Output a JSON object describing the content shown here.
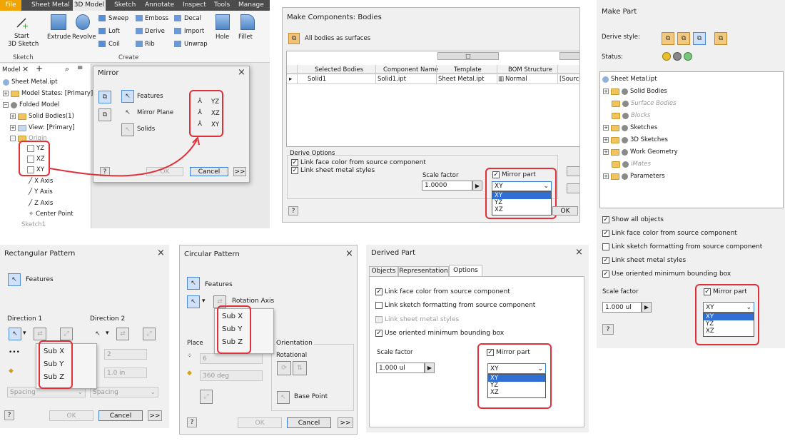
{
  "colors": {
    "highlight": "#e0313a",
    "selection": "#2f6fd6",
    "ribbon_tab_active": "#f0a500"
  },
  "ribbon": {
    "tabs": [
      "File",
      "Sheet Metal",
      "3D Model",
      "Sketch",
      "Annotate",
      "Inspect",
      "Tools",
      "Manage"
    ],
    "active_tab": "3D Model",
    "start_sketch": "Start\n3D Sketch",
    "start_sketch_l1": "Start",
    "start_sketch_l2": "3D Sketch",
    "extrude": "Extrude",
    "revolve": "Revolve",
    "sweep": "Sweep",
    "loft": "Loft",
    "coil": "Coil",
    "emboss": "Emboss",
    "derive": "Derive",
    "rib": "Rib",
    "decal": "Decal",
    "import": "Import",
    "unwrap": "Unwrap",
    "hole": "Hole",
    "fillet": "Fillet",
    "group_sketch": "Sketch",
    "group_create": "Create"
  },
  "browser": {
    "tab": "Model",
    "items": [
      "Sheet Metal.ipt",
      "Model States: [Primary]",
      "Folded Model",
      "Solid Bodies(1)",
      "View: [Primary]",
      "Origin",
      "YZ",
      "XZ",
      "XY",
      "X Axis",
      "Y Axis",
      "Z Axis",
      "Center Point",
      "Sketch1"
    ]
  },
  "mirror": {
    "title": "Mirror",
    "features": "Features",
    "mirror_plane": "Mirror Plane",
    "solids": "Solids",
    "planes": [
      "YZ",
      "XZ",
      "XY"
    ],
    "ok": "OK",
    "cancel": "Cancel",
    "more": ">>",
    "help": "?"
  },
  "make_components": {
    "title": "Make Components: Bodies",
    "all_bodies": "All bodies as surfaces",
    "headers": [
      "Selected Bodies",
      "Component Name",
      "Template",
      "BOM Structure"
    ],
    "row": {
      "body": "Solid1",
      "component": "Solid1.ipt",
      "template": "Sheet Metal.ipt",
      "bom": "Normal",
      "source": "[Source"
    },
    "derive_options": "Derive Options",
    "link_face": "Link face color from source component",
    "link_sheet": "Link sheet metal styles",
    "scale_label": "Scale factor",
    "scale_value": "1.0000",
    "mirror_part": "Mirror part",
    "mirror_value": "XY",
    "mirror_options": [
      "XY",
      "YZ",
      "XZ"
    ],
    "ok": "OK",
    "help": "?"
  },
  "make_part": {
    "title": "Make Part",
    "derive_style": "Derive style:",
    "status": "Status:",
    "tree": [
      "Sheet Metal.ipt",
      "Solid Bodies",
      "Surface Bodies",
      "Blocks",
      "Sketches",
      "3D Sketches",
      "Work Geometry",
      "iMates",
      "Parameters"
    ],
    "show_all": "Show all objects",
    "link_face": "Link face color from source component",
    "link_sketch": "Link sketch formatting from source component",
    "link_sheet": "Link sheet metal styles",
    "oriented_box": "Use oriented minimum bounding box",
    "scale_label": "Scale factor",
    "scale_value": "1.000 ul",
    "mirror_part": "Mirror part",
    "mirror_value": "XY",
    "mirror_options": [
      "XY",
      "YZ",
      "XZ"
    ],
    "help": "?"
  },
  "rect_pattern": {
    "title": "Rectangular Pattern",
    "features": "Features",
    "dir1": "Direction 1",
    "dir2": "Direction 2",
    "subs": [
      "Sub X",
      "Sub Y",
      "Sub Z"
    ],
    "count": "2",
    "spacing_val": "1.0 in",
    "spacing": "Spacing",
    "spacing2": "Spacing",
    "ok": "OK",
    "cancel": "Cancel",
    "more": ">>",
    "help": "?"
  },
  "circ_pattern": {
    "title": "Circular Pattern",
    "features": "Features",
    "rotation_axis": "Rotation Axis",
    "subs": [
      "Sub X",
      "Sub Y",
      "Sub Z"
    ],
    "placement": "Place",
    "count": "6",
    "angle": "360 deg",
    "orientation": "Orientation",
    "rotational": "Rotational",
    "base_point": "Base Point",
    "ok": "OK",
    "cancel": "Cancel",
    "more": ">>",
    "help": "?"
  },
  "derived_part": {
    "title": "Derived Part",
    "tabs": [
      "Objects",
      "Representation",
      "Options"
    ],
    "active_tab": "Options",
    "link_face": "Link face color from source component",
    "link_sketch": "Link sketch formatting from source component",
    "link_sheet": "Link sheet metal styles",
    "oriented_box": "Use oriented minimum bounding box",
    "scale_label": "Scale factor",
    "scale_value": "1.000 ul",
    "mirror_part": "Mirror part",
    "mirror_value": "XY",
    "mirror_options": [
      "XY",
      "YZ",
      "XZ"
    ]
  }
}
